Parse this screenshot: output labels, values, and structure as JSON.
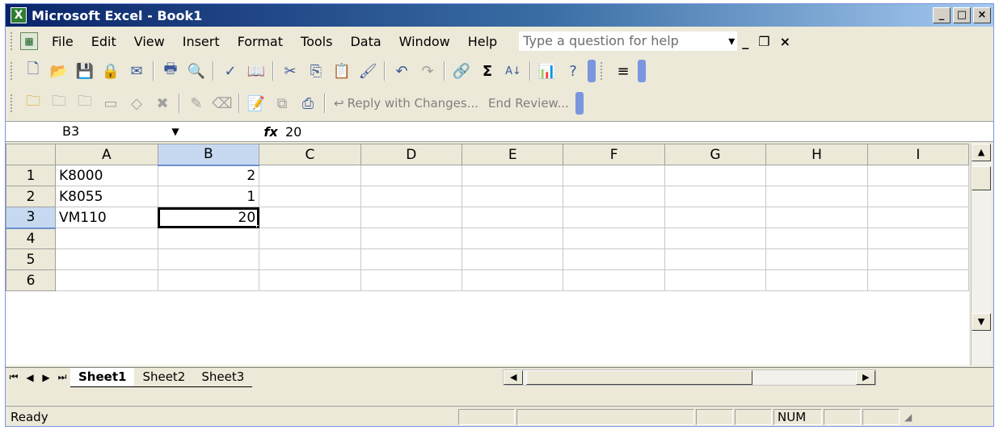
{
  "window": {
    "title": "Microsoft Excel - Book1"
  },
  "menubar": {
    "items": [
      "File",
      "Edit",
      "View",
      "Insert",
      "Format",
      "Tools",
      "Data",
      "Window",
      "Help"
    ],
    "help_placeholder": "Type a question for help"
  },
  "reviewing": {
    "reply_label": "Reply with Changes...",
    "end_label": "End Review..."
  },
  "formula": {
    "name_box": "B3",
    "fx": "fx",
    "value": "20"
  },
  "grid": {
    "columns": [
      "A",
      "B",
      "C",
      "D",
      "E",
      "F",
      "G",
      "H",
      "I"
    ],
    "rows": [
      {
        "num": "1",
        "a": "K8000",
        "b": "2"
      },
      {
        "num": "2",
        "a": "K8055",
        "b": "1"
      },
      {
        "num": "3",
        "a": "VM110",
        "b": "20"
      },
      {
        "num": "4",
        "a": "",
        "b": ""
      },
      {
        "num": "5",
        "a": "",
        "b": ""
      },
      {
        "num": "6",
        "a": "",
        "b": ""
      }
    ],
    "active_cell": "B3"
  },
  "sheets": {
    "tabs": [
      "Sheet1",
      "Sheet2",
      "Sheet3"
    ],
    "active": "Sheet1"
  },
  "statusbar": {
    "text": "Ready",
    "num_indicator": "NUM"
  }
}
